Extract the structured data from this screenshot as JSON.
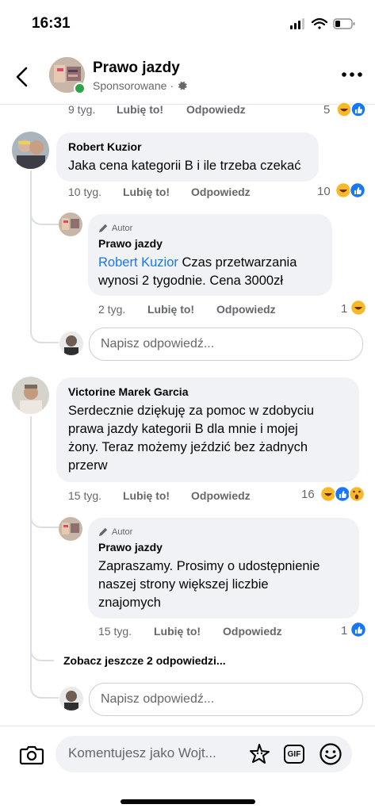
{
  "status_bar": {
    "time": "16:31"
  },
  "header": {
    "title": "Prawo jazdy",
    "subtitle": "Sponsorowane",
    "separator": "·"
  },
  "top_row": {
    "time": "9 tyg.",
    "like": "Lubię to!",
    "reply": "Odpowiedz",
    "reaction_count": "5"
  },
  "comments": [
    {
      "author": "Robert Kuzior",
      "text": "Jaka cena kategorii B i ile trzeba czekać",
      "time": "10 tyg.",
      "like": "Lubię to!",
      "reply": "Odpowiedz",
      "reaction_count": "10",
      "replies": [
        {
          "badge": "Autor",
          "author": "Prawo jazdy",
          "mention": "Robert Kuzior",
          "text_line1": "Czas przetwarzania",
          "text_line2": "wynosi 2 tygodnie. Cena 3000zł",
          "time": "2 tyg.",
          "like": "Lubię to!",
          "reply": "Odpowiedz",
          "reaction_count": "1"
        }
      ],
      "reply_placeholder": "Napisz odpowiedź..."
    },
    {
      "author": "Victorine Marek Garcia",
      "text_lines": [
        "Serdecznie dziękuję za pomoc w zdobyciu",
        "prawa jazdy kategorii B dla mnie i mojej",
        "żony. Teraz możemy jeździć bez żadnych",
        "przerw"
      ],
      "time": "15 tyg.",
      "like": "Lubię to!",
      "reply": "Odpowiedz",
      "reaction_count": "16",
      "replies": [
        {
          "badge": "Autor",
          "author": "Prawo jazdy",
          "text_lines": [
            "Zapraszamy. Prosimy o udostępnienie",
            "naszej strony większej liczbie",
            "znajomych"
          ],
          "time": "15 tyg.",
          "like": "Lubię to!",
          "reply": "Odpowiedz",
          "reaction_count": "1"
        }
      ],
      "more_replies": "Zobacz jeszcze 2 odpowiedzi...",
      "reply_placeholder": "Napisz odpowiedź..."
    }
  ],
  "composer": {
    "placeholder": "Komentujesz jako Wojt...",
    "gif_label": "GIF"
  },
  "colors": {
    "link": "#1877f2",
    "meta": "#65676b",
    "bubble": "#f0f2f5",
    "like_blue": "#1877f2",
    "emoji_yellow": "#f7b928"
  },
  "icons": [
    "back-arrow-icon",
    "gear-icon",
    "more-dots-icon",
    "camera-icon",
    "sticker-icon",
    "gif-icon",
    "emoji-smile-icon",
    "pencil-icon",
    "haha-emoji-icon",
    "like-icon",
    "wow-emoji-icon"
  ]
}
